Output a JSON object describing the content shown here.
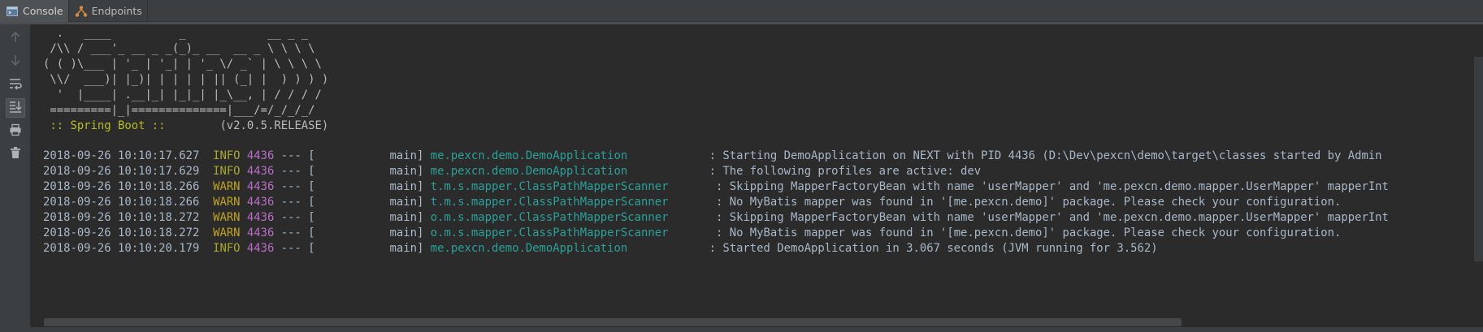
{
  "tabs": [
    {
      "label": "Console",
      "icon": "console-icon",
      "active": true
    },
    {
      "label": "Endpoints",
      "icon": "endpoints-icon",
      "active": false
    }
  ],
  "toolbar": [
    {
      "name": "scroll-up-icon",
      "enabled": false
    },
    {
      "name": "scroll-down-icon",
      "enabled": false
    },
    {
      "name": "soft-wrap-icon",
      "enabled": true
    },
    {
      "name": "scroll-to-end-icon",
      "enabled": true,
      "toggled": true
    },
    {
      "name": "print-icon",
      "enabled": true
    },
    {
      "name": "clear-all-icon",
      "enabled": true
    }
  ],
  "banner": [
    "  .   ____          _            __ _ _",
    " /\\\\ / ___'_ __ _ _(_)_ __  __ _ \\ \\ \\ \\",
    "( ( )\\___ | '_ | '_| | '_ \\/ _` | \\ \\ \\ \\",
    " \\\\/  ___)| |_)| | | | | || (_| |  ) ) ) )",
    "  '  |____| .__|_| |_|_| |_\\__, | / / / /",
    " =========|_|==============|___/=/_/_/_/"
  ],
  "spring": {
    "label": " :: Spring Boot :: ",
    "version": "       (v2.0.5.RELEASE)"
  },
  "log": [
    {
      "ts": "2018-09-26 10:10:17.627",
      "level": "INFO",
      "pid": "4436",
      "sep": " --- [",
      "thread": "           main] ",
      "logger": "me.pexcn.demo.DemoApplication           ",
      "msg": " : Starting DemoApplication on NEXT with PID 4436 (D:\\Dev\\pexcn\\demo\\target\\classes started by Admin"
    },
    {
      "ts": "2018-09-26 10:10:17.629",
      "level": "INFO",
      "pid": "4436",
      "sep": " --- [",
      "thread": "           main] ",
      "logger": "me.pexcn.demo.DemoApplication           ",
      "msg": " : The following profiles are active: dev"
    },
    {
      "ts": "2018-09-26 10:10:18.266",
      "level": "WARN",
      "pid": "4436",
      "sep": " --- [",
      "thread": "           main] ",
      "logger": "t.m.s.mapper.ClassPathMapperScanner      ",
      "msg": " : Skipping MapperFactoryBean with name 'userMapper' and 'me.pexcn.demo.mapper.UserMapper' mapperInt"
    },
    {
      "ts": "2018-09-26 10:10:18.266",
      "level": "WARN",
      "pid": "4436",
      "sep": " --- [",
      "thread": "           main] ",
      "logger": "t.m.s.mapper.ClassPathMapperScanner      ",
      "msg": " : No MyBatis mapper was found in '[me.pexcn.demo]' package. Please check your configuration."
    },
    {
      "ts": "2018-09-26 10:10:18.272",
      "level": "WARN",
      "pid": "4436",
      "sep": " --- [",
      "thread": "           main] ",
      "logger": "o.m.s.mapper.ClassPathMapperScanner      ",
      "msg": " : Skipping MapperFactoryBean with name 'userMapper' and 'me.pexcn.demo.mapper.UserMapper' mapperInt"
    },
    {
      "ts": "2018-09-26 10:10:18.272",
      "level": "WARN",
      "pid": "4436",
      "sep": " --- [",
      "thread": "           main] ",
      "logger": "o.m.s.mapper.ClassPathMapperScanner      ",
      "msg": " : No MyBatis mapper was found in '[me.pexcn.demo]' package. Please check your configuration."
    },
    {
      "ts": "2018-09-26 10:10:20.179",
      "level": "INFO",
      "pid": "4436",
      "sep": " --- [",
      "thread": "           main] ",
      "logger": "me.pexcn.demo.DemoApplication           ",
      "msg": " : Started DemoApplication in 3.067 seconds (JVM running for 3.562)"
    }
  ],
  "colors": {
    "background": "#2b2b2b",
    "info": "#a9a92d",
    "warn": "#c2a41c",
    "pid": "#b96ec6",
    "logger": "#2aa198",
    "spring": "#b9bd1b"
  }
}
